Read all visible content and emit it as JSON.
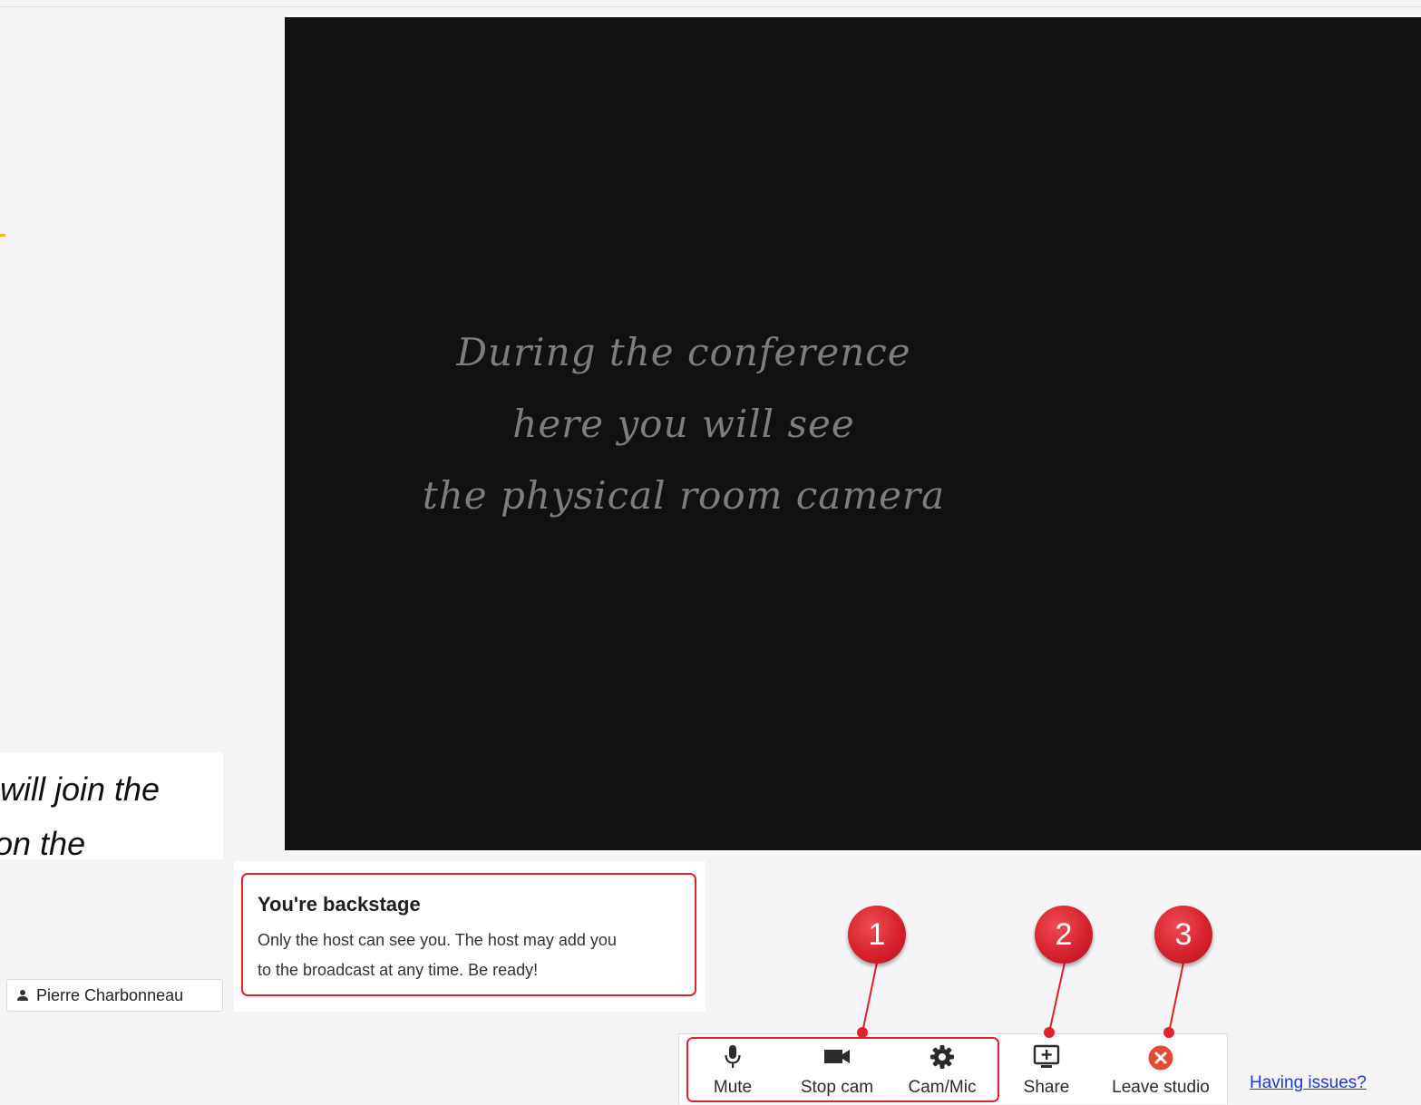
{
  "stage": {
    "lines": [
      "During the conference",
      "here you will see",
      "the physical room camera"
    ]
  },
  "side_note": {
    "line1": "will join the",
    "line2": "on the"
  },
  "participant": {
    "name": "Pierre Charbonneau",
    "icon": "person-icon"
  },
  "backstage": {
    "title": "You're backstage",
    "body_line1": "Only the host can see you. The host may add you",
    "body_line2": "to the broadcast at any time. Be ready!"
  },
  "toolbar": {
    "mute_label": "Mute",
    "mute_icon": "microphone-icon",
    "stopcam_label": "Stop cam",
    "stopcam_icon": "video-camera-icon",
    "cammic_label": "Cam/Mic",
    "cammic_icon": "gear-icon",
    "share_label": "Share",
    "share_icon": "screen-share-icon",
    "leave_label": "Leave studio",
    "leave_icon": "close-circle-icon"
  },
  "help_link": "Having issues?",
  "callouts": [
    "1",
    "2",
    "3"
  ],
  "colors": {
    "annotation_red": "#e0222b",
    "stage_bg": "#111111",
    "leave_red": "#e24a33",
    "link_blue": "#1a3bcc"
  }
}
